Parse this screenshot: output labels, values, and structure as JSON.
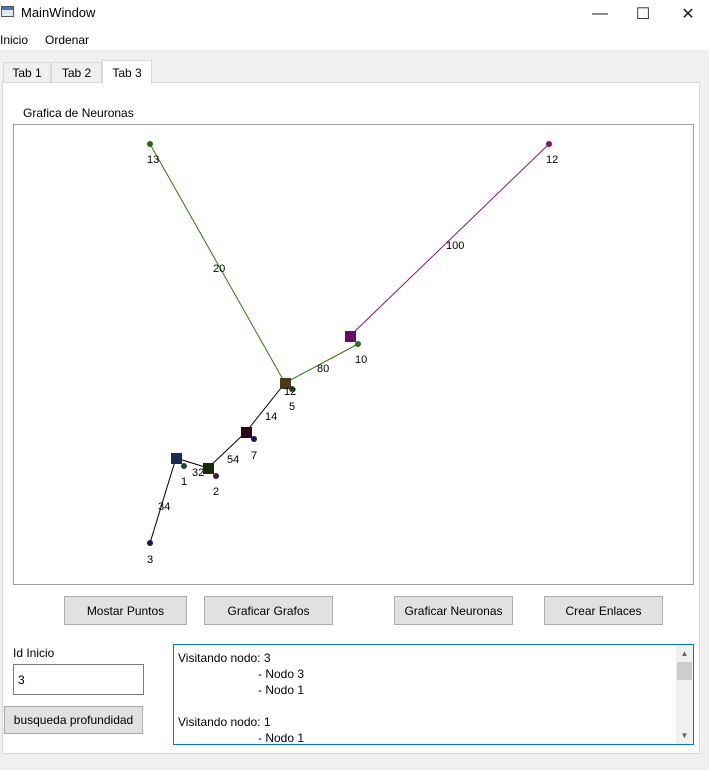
{
  "window": {
    "title": "MainWindow",
    "controls": {
      "minimize": "—",
      "maximize": "☐",
      "close": "✕"
    }
  },
  "menu": [
    "Inicio",
    "Ordenar"
  ],
  "tabs": [
    {
      "label": "Tab 1",
      "active": false
    },
    {
      "label": "Tab 2",
      "active": false
    },
    {
      "label": "Tab 3",
      "active": true
    }
  ],
  "graph_panel": {
    "title": "Grafica de Neuronas",
    "nodes": [
      {
        "id": "13",
        "label": "13",
        "color": "#2e6a18",
        "shape": "dot"
      },
      {
        "id": "12",
        "label": "12",
        "color": "#7a1a6e",
        "shape": "dot"
      },
      {
        "id": "10",
        "label": "10",
        "color": "#2e6a18",
        "shape": "dot"
      },
      {
        "id": "5",
        "label": "5",
        "color": "#2e4a1a",
        "shape": "dot"
      },
      {
        "id": "12b",
        "label": "12",
        "color": "#4a3a1a",
        "shape": "square"
      },
      {
        "id": "7",
        "label": "7",
        "color": "#1a1a5a",
        "shape": "dot"
      },
      {
        "id": "2",
        "label": "2",
        "color": "#4a1a2a",
        "shape": "dot"
      },
      {
        "id": "1",
        "label": "1",
        "color": "#1a4a2a",
        "shape": "dot"
      },
      {
        "id": "3",
        "label": "3",
        "color": "#1a1a4a",
        "shape": "dot"
      }
    ],
    "squares": [
      {
        "color": "#6a0a6a"
      },
      {
        "color": "#4a3a1a"
      },
      {
        "color": "#2a0a18"
      },
      {
        "color": "#1a2a0a"
      },
      {
        "color": "#1a2a4a"
      }
    ],
    "edges": [
      {
        "weight": "20",
        "color": "#2e7a10"
      },
      {
        "weight": "100",
        "color": "#7a1a7a"
      },
      {
        "weight": "80",
        "color": "#2e7a10"
      },
      {
        "weight": "14",
        "color": "#000000"
      },
      {
        "weight": "54",
        "color": "#000000"
      },
      {
        "weight": "32",
        "color": "#000000"
      },
      {
        "weight": "34",
        "color": "#000000"
      }
    ]
  },
  "buttons": {
    "mostrar_puntos": "Mostar Puntos",
    "graficar_grafos": "Graficar Grafos",
    "graficar_neuronas": "Graficar Neuronas",
    "crear_enlaces": "Crear Enlaces",
    "busqueda": "busqueda profundidad"
  },
  "id_inicio": {
    "label": "Id Inicio",
    "value": "3"
  },
  "output": {
    "text": "Visitando nodo: 3\n                        - Nodo 3\n                        - Nodo 1\n\nVisitando nodo: 1\n                        - Nodo 1"
  }
}
